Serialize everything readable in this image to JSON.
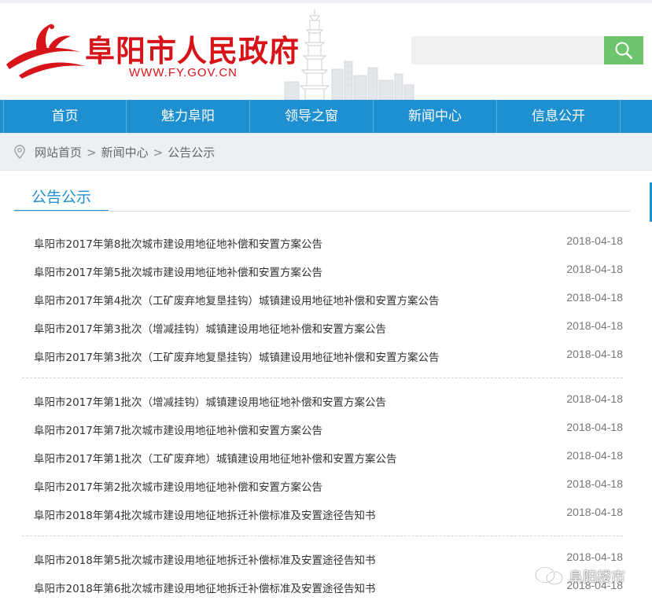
{
  "header": {
    "site_title": "阜阳市人民政府",
    "site_url": "WWW.FY.GOV.CN",
    "search_placeholder": "",
    "search_value": ""
  },
  "nav": {
    "items": [
      {
        "label": "首页"
      },
      {
        "label": "魅力阜阳"
      },
      {
        "label": "领导之窗"
      },
      {
        "label": "新闻中心"
      },
      {
        "label": "信息公开"
      }
    ]
  },
  "breadcrumb": {
    "items": [
      "网站首页",
      "新闻中心",
      "公告公示"
    ],
    "separator": ">"
  },
  "section": {
    "title": "公告公示"
  },
  "news": [
    {
      "title": "阜阳市2017年第8批次城市建设用地征地补偿和安置方案公告",
      "date": "2018-04-18"
    },
    {
      "title": "阜阳市2017年第5批次城市建设用地征地补偿和安置方案公告",
      "date": "2018-04-18"
    },
    {
      "title": "阜阳市2017年第4批次（工矿废弃地复垦挂钩）城镇建设用地征地补偿和安置方案公告",
      "date": "2018-04-18"
    },
    {
      "title": "阜阳市2017年第3批次（增减挂钩）城镇建设用地征地补偿和安置方案公告",
      "date": "2018-04-18"
    },
    {
      "title": "阜阳市2017年第3批次（工矿废弃地复垦挂钩）城镇建设用地征地补偿和安置方案公告",
      "date": "2018-04-18"
    },
    {
      "title": "阜阳市2017年第1批次（增减挂钩）城镇建设用地征地补偿和安置方案公告",
      "date": "2018-04-18"
    },
    {
      "title": "阜阳市2017年第7批次城市建设用地征地补偿和安置方案公告",
      "date": "2018-04-18"
    },
    {
      "title": "阜阳市2017年第1批次（工矿废弃地）城镇建设用地征地补偿和安置方案公告",
      "date": "2018-04-18"
    },
    {
      "title": "阜阳市2017年第2批次城市建设用地征地补偿和安置方案公告",
      "date": "2018-04-18"
    },
    {
      "title": "阜阳市2018年第4批次城市建设用地征地拆迁补偿标准及安置途径告知书",
      "date": "2018-04-18"
    },
    {
      "title": "阜阳市2018年第5批次城市建设用地征地拆迁补偿标准及安置途径告知书",
      "date": "2018-04-18"
    },
    {
      "title": "阜阳市2018年第6批次城市建设用地征地拆迁补偿标准及安置途径告知书",
      "date": "2018-04-18"
    }
  ],
  "watermark": {
    "text": "阜阳楼市",
    "icon": "wechat-icon"
  },
  "colors": {
    "brand_red": "#d7141a",
    "nav_blue": "#1e8fd0",
    "search_green": "#6cc56c"
  },
  "icons": {
    "logo": "phoenix-ribbon-logo",
    "search": "search-icon",
    "location": "map-pin-icon",
    "tower": "pagoda-skyline"
  }
}
